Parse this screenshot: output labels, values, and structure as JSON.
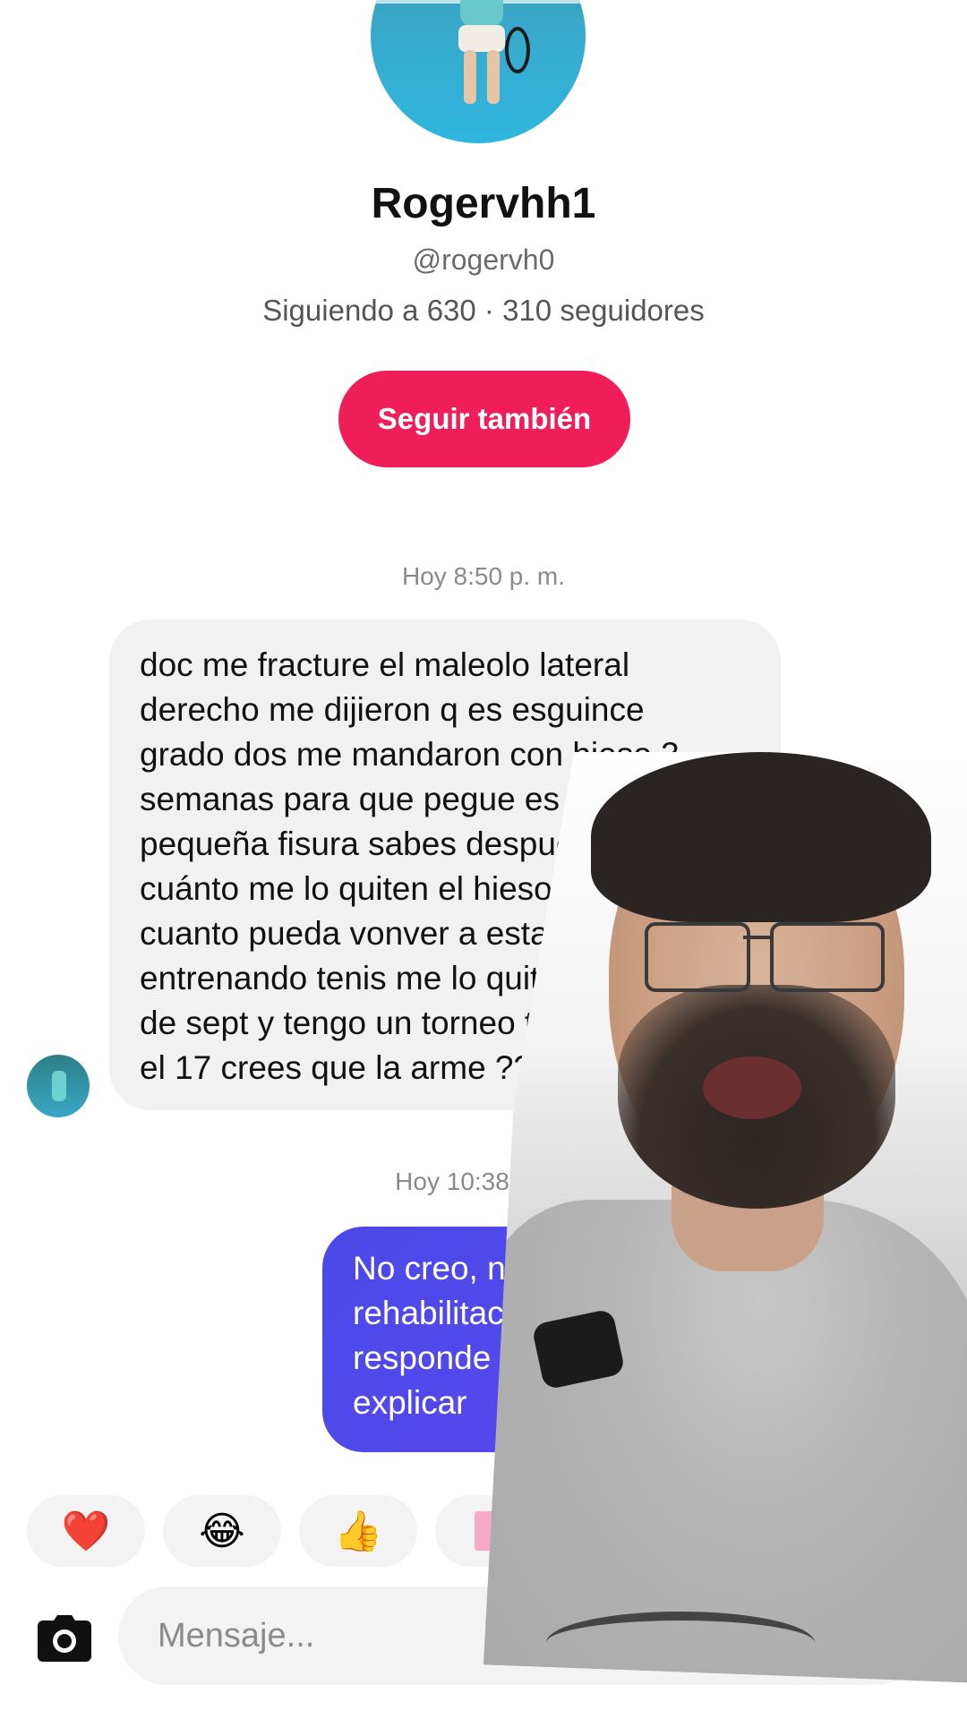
{
  "profile": {
    "name": "Rogervhh1",
    "handle": "@rogervh0",
    "stats": "Siguiendo a 630 · 310 seguidores",
    "follow_label": "Seguir también"
  },
  "conversation": {
    "timestamp_1": "Hoy 8:50 p. m.",
    "incoming_lines": [
      "doc me fracture el maleolo lateral",
      "derecho me dijieron q es esguince",
      "grado dos me mandaron con hieso 3",
      "semanas para que pegue es una",
      "pequeña fisura sabes después c",
      "cuánto me lo quiten el hieso en",
      "cuanto pueda vonver a estar",
      "entrenando tenis  me lo quitan",
      "de sept y tengo un torneo tran",
      "el 17 crees que la arme ?? salu"
    ],
    "timestamp_2": "Hoy 10:38 p. m.",
    "outgoing_lines": [
      "No creo, n",
      "rehabilitac",
      "responde",
      "explicar"
    ]
  },
  "reactions": [
    "❤️",
    "😂",
    "👍"
  ],
  "composer": {
    "placeholder": "Mensaje..."
  },
  "colors": {
    "follow_button": "#f01d5b",
    "outgoing_bubble": "#4b49e8",
    "incoming_bubble": "#f1f1f2"
  }
}
